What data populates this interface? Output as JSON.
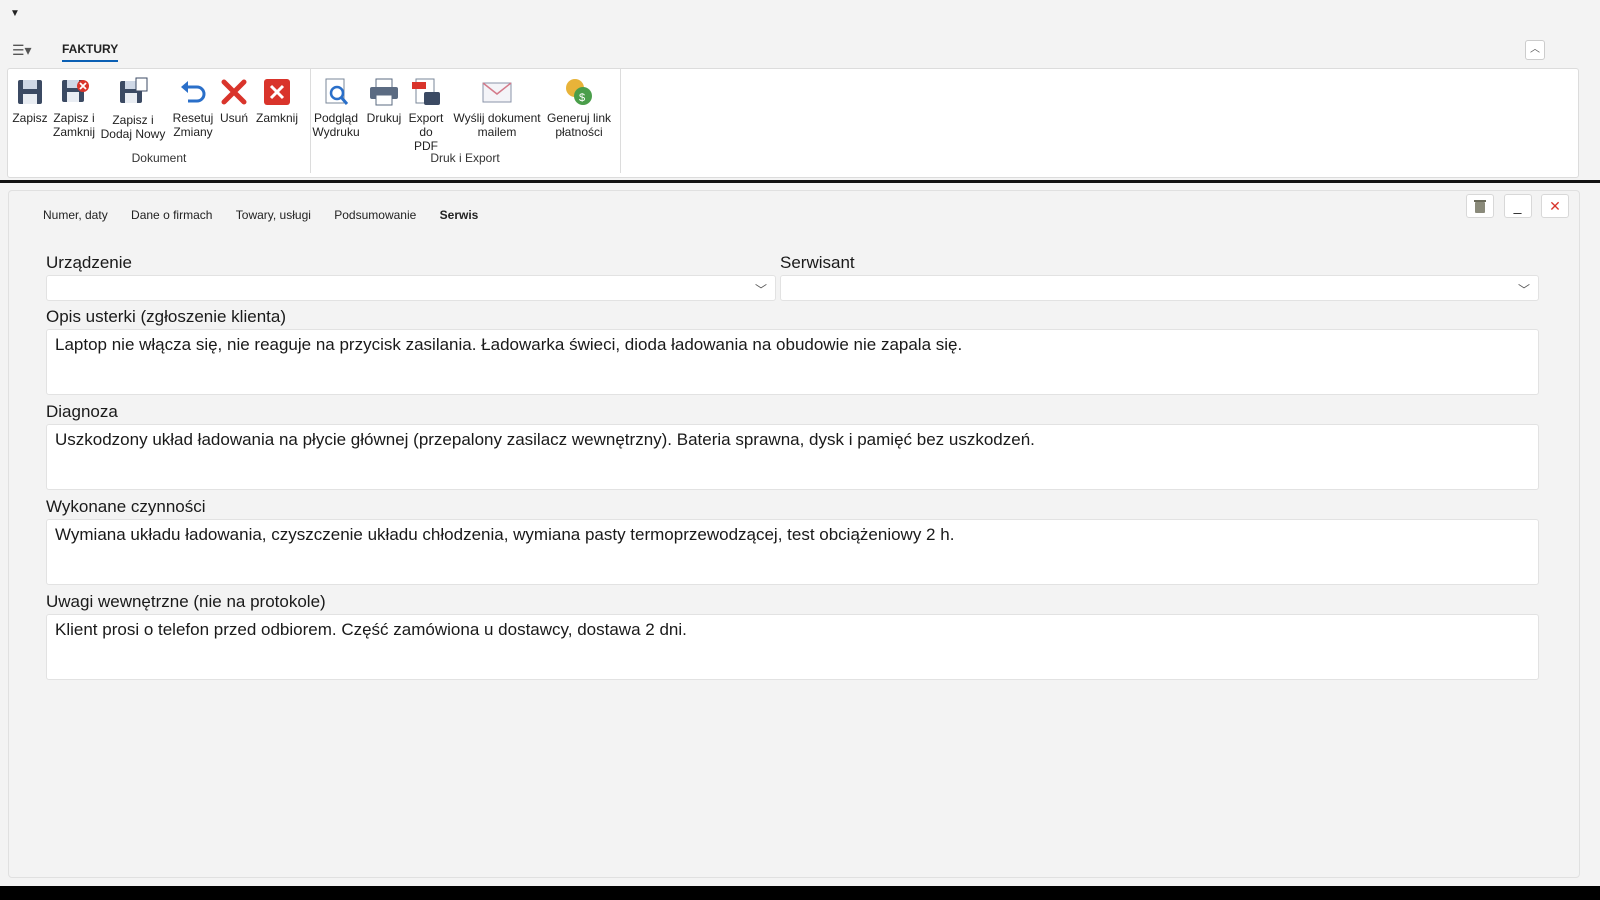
{
  "quick_access": {
    "icon": "dropdown-arrow-icon"
  },
  "ribbon_tabs": {
    "app_menu_icon": "list-menu-icon",
    "active_tab": "FAKTURY"
  },
  "ribbon": {
    "groups": [
      {
        "label": "Dokument",
        "buttons": [
          {
            "line1": "Zapisz",
            "line2": "",
            "icon": "save-icon"
          },
          {
            "line1": "Zapisz i",
            "line2": "Zamknij",
            "icon": "save-close-icon"
          },
          {
            "line1": "Zapisz i",
            "line2": "Dodaj Nowy",
            "icon": "save-new-icon"
          },
          {
            "line1": "Resetuj",
            "line2": "Zmiany",
            "icon": "undo-icon"
          },
          {
            "line1": "Usuń",
            "line2": "",
            "icon": "delete-icon"
          },
          {
            "line1": "Zamknij",
            "line2": "",
            "icon": "close-icon"
          }
        ]
      },
      {
        "label": "Druk i Export",
        "buttons": [
          {
            "line1": "Podgląd",
            "line2": "Wydruku",
            "icon": "print-preview-icon"
          },
          {
            "line1": "Drukuj",
            "line2": "",
            "icon": "printer-icon"
          },
          {
            "line1": "Export",
            "line2": "do PDF",
            "icon": "pdf-export-icon"
          },
          {
            "line1": "Wyślij dokument",
            "line2": "mailem",
            "icon": "mail-icon"
          },
          {
            "line1": "Generuj link",
            "line2": "płatności",
            "icon": "payment-link-icon"
          }
        ]
      }
    ]
  },
  "doc_tabs": [
    {
      "label": "Numer, daty"
    },
    {
      "label": "Dane o firmach"
    },
    {
      "label": "Towary, usługi"
    },
    {
      "label": "Podsumowanie"
    },
    {
      "label": "Serwis",
      "active": true
    }
  ],
  "window_buttons": {
    "delete_icon": "trash-icon",
    "minimize": "_",
    "close_icon": "close-icon"
  },
  "form": {
    "device": {
      "label": "Urządzenie",
      "value": ""
    },
    "technician": {
      "label": "Serwisant",
      "value": ""
    },
    "fault": {
      "label": "Opis usterki (zgłoszenie klienta)",
      "value": "Laptop nie włącza się, nie reaguje na przycisk zasilania. Ładowarka świeci, dioda ładowania na obudowie nie zapala się."
    },
    "diagnosis": {
      "label": "Diagnoza",
      "value": "Uszkodzony układ ładowania na płycie głównej (przepalony zasilacz wewnętrzny). Bateria sprawna, dysk i pamięć bez uszkodzeń."
    },
    "actions": {
      "label": "Wykonane czynności",
      "value": "Wymiana układu ładowania, czyszczenie układu chłodzenia, wymiana pasty termoprzewodzącej, test obciążeniowy 2 h."
    },
    "notes": {
      "label": "Uwagi wewnętrzne (nie na protokole)",
      "value": "Klient prosi o telefon przed odbiorem. Część zamówiona u dostawcy, dostawa 2 dni."
    }
  },
  "colors": {
    "accent": "#0a5fb4",
    "danger": "#d9342b"
  }
}
